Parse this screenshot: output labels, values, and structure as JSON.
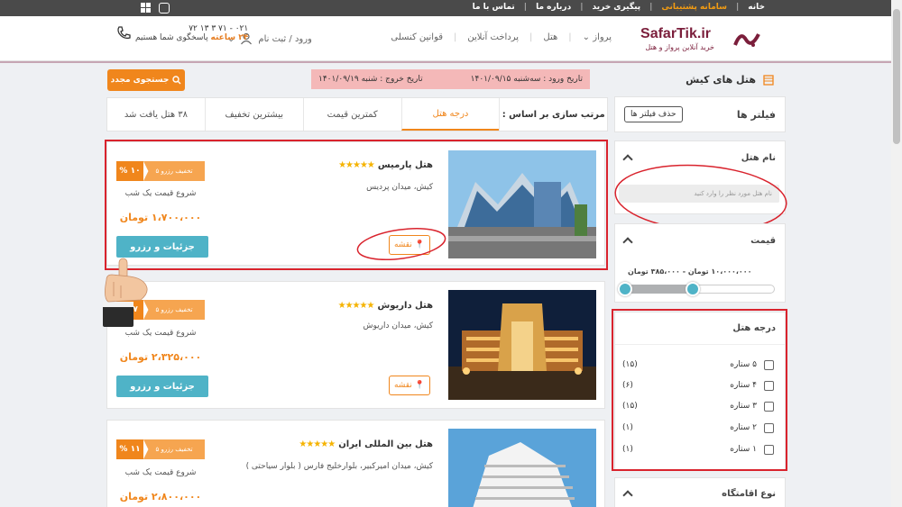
{
  "topbar": {
    "links": [
      "خانه",
      "سامانه پشتیبانی",
      "پیگیری خرید",
      "درباره ما",
      "تماس با ما"
    ],
    "active_index": 1
  },
  "header": {
    "brand_title": "SafarTik.ir",
    "brand_subtitle": "خرید آنلاین پرواز و هتل",
    "nav": [
      "پرواز",
      "هتل",
      "پرداخت آنلاین",
      "قوانین کنسلی"
    ],
    "login": "ورود / ثبت نام",
    "support_phone": "۰۲۱ - ۷۱ ۳ ۱۳ ۷۲",
    "support_hours": "۲۴ ساعته",
    "support_text": "پاسخگوی شما هستیم"
  },
  "search": {
    "page_title": "هتل های کیش",
    "checkin": "تاریخ ورود : سه‌شنبه ۱۴۰۱/۰۹/۱۵",
    "checkout": "تاریخ خروج : شنبه ۱۴۰۱/۰۹/۱۹",
    "research_button": "جستجوی مجدد"
  },
  "sort": {
    "label": "مرتب سازی بر اساس :",
    "options": [
      "درجه هتل",
      "کمترین قیمت",
      "بیشترین تخفیف",
      "۳۸ هتل یافت شد"
    ],
    "active_index": 0
  },
  "filters": {
    "title": "فیلتر ها",
    "clear_button": "حذف فیلتر ها",
    "hotel_name": {
      "title": "نام هتل",
      "placeholder": "نام هتل مورد نظر را وارد کنید"
    },
    "price": {
      "title": "قیمت",
      "range_text": "۱۰،۰۰۰،۰۰۰ تومان - ۳۸۵،۰۰۰ تومان"
    },
    "stars": {
      "title": "درجه هتل",
      "items": [
        {
          "label": "۵ ستاره",
          "count": "(۱۵)"
        },
        {
          "label": "۴ ستاره",
          "count": "(۶)"
        },
        {
          "label": "۳ ستاره",
          "count": "(۱۵)"
        },
        {
          "label": "۲ ستاره",
          "count": "(۱)"
        },
        {
          "label": "۱ ستاره",
          "count": "(۱)"
        }
      ]
    },
    "stay_type": {
      "title": "نوع اقامتگاه"
    }
  },
  "hotels": [
    {
      "name": "هتل پارمیس",
      "stars": "★★★★★",
      "location": "کیش، میدان پردیس",
      "map_label": "نقشه",
      "discount_label": "تخفیف رزرو ۵",
      "discount_pct": "۱۰ %",
      "from_text": "شروع قیمت یک شب",
      "price": "۱،۷۰۰،۰۰۰ تومان",
      "reserve_label": "جزئیات و رزرو"
    },
    {
      "name": "هتل داریوش",
      "stars": "★★★★★",
      "location": "کیش، میدان داریوش",
      "map_label": "نقشه",
      "discount_label": "تخفیف رزرو ۵",
      "discount_pct": "۷ %",
      "from_text": "شروع قیمت یک شب",
      "price": "۲،۳۲۵،۰۰۰ تومان",
      "reserve_label": "جزئیات و رزرو"
    },
    {
      "name": "هتل بین المللی ایران",
      "stars": "★★★★★",
      "location": "کیش، میدان امیرکبیر، بلوارخلیج فارس ( بلوار سیاحتی )",
      "map_label": "نقشه",
      "discount_label": "تخفیف رزرو ۵",
      "discount_pct": "۱۱ %",
      "from_text": "شروع قیمت یک شب",
      "price": "۲،۸۰۰،۰۰۰ تومان",
      "reserve_label": "جزئیات و رزرو"
    }
  ],
  "colors": {
    "accent": "#f0861c",
    "teal": "#4fb3c7",
    "brand": "#7b1e3b",
    "highlight": "#d9232d"
  }
}
